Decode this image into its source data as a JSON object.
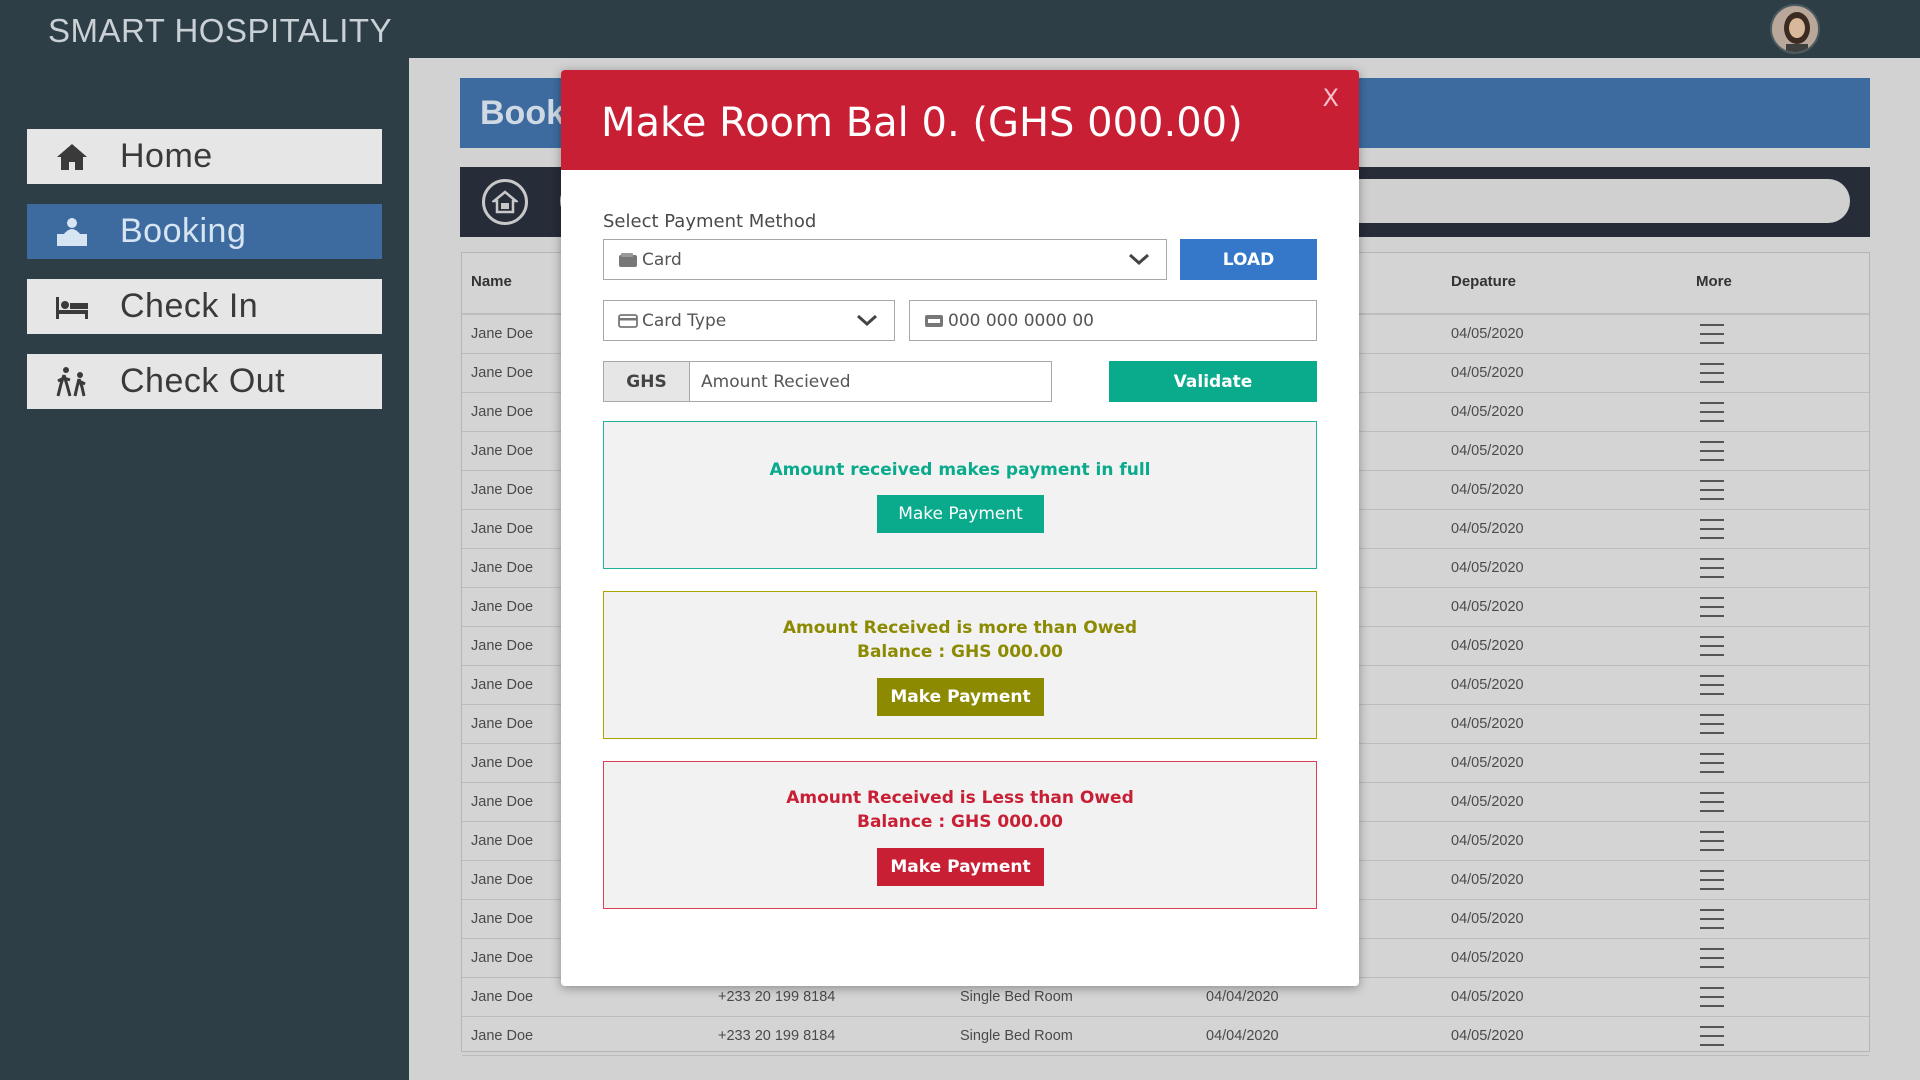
{
  "app": {
    "title": "SMART HOSPITALITY"
  },
  "sidebar": {
    "items": [
      {
        "label": "Home",
        "icon": "home-icon"
      },
      {
        "label": "Booking",
        "icon": "reception-desk-icon",
        "active": true
      },
      {
        "label": "Check In",
        "icon": "bed-icon"
      },
      {
        "label": "Check Out",
        "icon": "walking-person-icon"
      }
    ]
  },
  "page": {
    "title": "Book"
  },
  "table": {
    "headers": {
      "name": "Name",
      "departure": "Depature",
      "more": "More"
    },
    "rows": [
      {
        "name": "Jane Doe",
        "phone": "",
        "room": "",
        "arrival": "",
        "departure": "04/05/2020"
      },
      {
        "name": "Jane Doe",
        "phone": "",
        "room": "",
        "arrival": "",
        "departure": "04/05/2020"
      },
      {
        "name": "Jane Doe",
        "phone": "",
        "room": "",
        "arrival": "",
        "departure": "04/05/2020"
      },
      {
        "name": "Jane Doe",
        "phone": "",
        "room": "",
        "arrival": "",
        "departure": "04/05/2020"
      },
      {
        "name": "Jane Doe",
        "phone": "",
        "room": "",
        "arrival": "",
        "departure": "04/05/2020"
      },
      {
        "name": "Jane Doe",
        "phone": "",
        "room": "",
        "arrival": "",
        "departure": "04/05/2020"
      },
      {
        "name": "Jane Doe",
        "phone": "",
        "room": "",
        "arrival": "",
        "departure": "04/05/2020"
      },
      {
        "name": "Jane Doe",
        "phone": "",
        "room": "",
        "arrival": "",
        "departure": "04/05/2020"
      },
      {
        "name": "Jane Doe",
        "phone": "",
        "room": "",
        "arrival": "",
        "departure": "04/05/2020"
      },
      {
        "name": "Jane Doe",
        "phone": "",
        "room": "",
        "arrival": "",
        "departure": "04/05/2020"
      },
      {
        "name": "Jane Doe",
        "phone": "",
        "room": "",
        "arrival": "",
        "departure": "04/05/2020"
      },
      {
        "name": "Jane Doe",
        "phone": "",
        "room": "",
        "arrival": "",
        "departure": "04/05/2020"
      },
      {
        "name": "Jane Doe",
        "phone": "",
        "room": "",
        "arrival": "",
        "departure": "04/05/2020"
      },
      {
        "name": "Jane Doe",
        "phone": "",
        "room": "",
        "arrival": "",
        "departure": "04/05/2020"
      },
      {
        "name": "Jane Doe",
        "phone": "",
        "room": "",
        "arrival": "",
        "departure": "04/05/2020"
      },
      {
        "name": "Jane Doe",
        "phone": "",
        "room": "",
        "arrival": "",
        "departure": "04/05/2020"
      },
      {
        "name": "Jane Doe",
        "phone": "",
        "room": "",
        "arrival": "",
        "departure": "04/05/2020"
      },
      {
        "name": "Jane Doe",
        "phone": "+233 20 199 8184",
        "room": "Single Bed Room",
        "arrival": "04/04/2020",
        "departure": "04/05/2020"
      },
      {
        "name": "Jane Doe",
        "phone": "+233 20 199 8184",
        "room": "Single Bed Room",
        "arrival": "04/04/2020",
        "departure": "04/05/2020"
      }
    ]
  },
  "modal": {
    "title": "Make Room Bal 0. (GHS 000.00)",
    "close_label": "X",
    "payment_method_label": "Select Payment Method",
    "payment_method_value": "Card",
    "load_label": "LOAD",
    "card_type_placeholder": "Card Type",
    "card_number_placeholder": "000 000 0000 00",
    "currency": "GHS",
    "amount_placeholder": "Amount Recieved",
    "validate_label": "Validate",
    "full": {
      "message": "Amount received makes payment in full",
      "button": "Make Payment"
    },
    "more": {
      "message": "Amount Received is more than Owed",
      "balance": "Balance : GHS 000.00",
      "button": "Make Payment"
    },
    "less": {
      "message": "Amount Received is Less than Owed",
      "balance": "Balance : GHS 000.00",
      "button": "Make Payment"
    }
  },
  "colors": {
    "accent_red": "#c91f35",
    "accent_blue": "#3d6ba0",
    "teal": "#0aab8c",
    "olive": "#8c8a00"
  }
}
